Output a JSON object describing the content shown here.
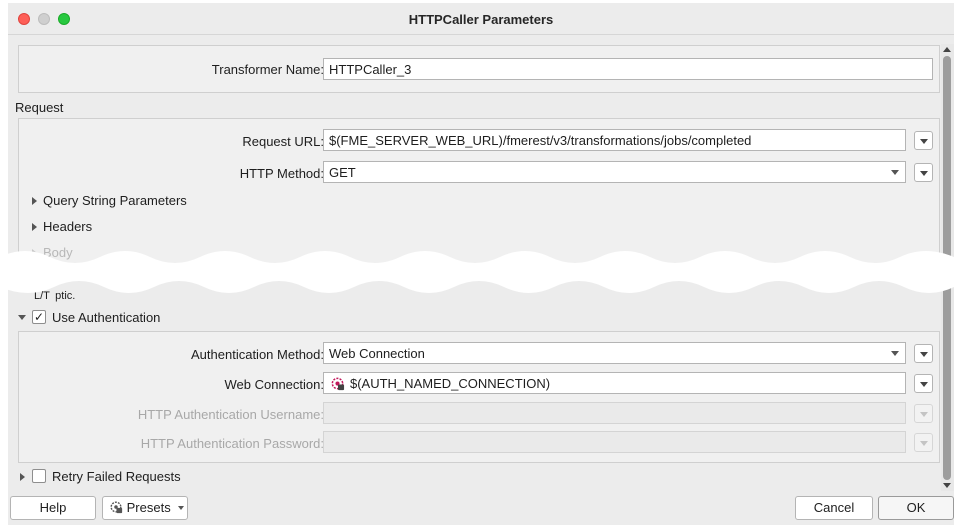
{
  "window": {
    "title": "HTTPCaller Parameters"
  },
  "transformer": {
    "label": "Transformer Name:",
    "value": "HTTPCaller_3"
  },
  "request": {
    "section_label": "Request",
    "url_label": "Request URL:",
    "url_value": "$(FME_SERVER_WEB_URL)/fmerest/v3/transformations/jobs/completed",
    "method_label": "HTTP Method:",
    "method_value": "GET",
    "groups": {
      "query": "Query String Parameters",
      "headers": "Headers",
      "body": "Body",
      "ssl_partial": "L/T   ptic."
    }
  },
  "auth": {
    "use_label": "Use Authentication",
    "use_checked": "✓",
    "method_label": "Authentication Method:",
    "method_value": "Web Connection",
    "connection_label": "Web Connection:",
    "connection_value": "$(AUTH_NAMED_CONNECTION)",
    "username_label": "HTTP Authentication Username:",
    "password_label": "HTTP Authentication Password:"
  },
  "retry": {
    "label": "Retry Failed Requests"
  },
  "footer": {
    "help": "Help",
    "presets": "Presets",
    "cancel": "Cancel",
    "ok": "OK"
  },
  "colors": {
    "close": "#fe5f57",
    "minimize": "#cfcfcf",
    "zoom": "#28c840",
    "connection_icon": "#c2185b"
  },
  "icons": {
    "connection": "gear-icon",
    "presets": "gear-icon"
  }
}
